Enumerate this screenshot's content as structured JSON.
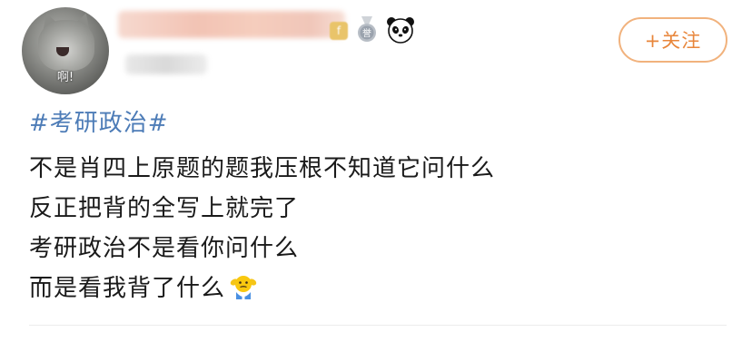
{
  "header": {
    "avatar_caption": "啊!",
    "follow_label": "+关注",
    "gold_badge_char": "f",
    "medal_char": "誉"
  },
  "post": {
    "hashtag": "#考研政治#",
    "lines": [
      "不是肖四上原题的题我压根不知道它问什么",
      "反正把背的全写上就完了",
      "考研政治不是看你问什么",
      "而是看我背了什么"
    ],
    "trailing_emoji": "shrug-emoji"
  },
  "colors": {
    "hashtag": "#4d7cb7",
    "follow_accent": "#e8863b",
    "follow_border": "#f1b27d",
    "body_text": "#1a1a1a"
  }
}
